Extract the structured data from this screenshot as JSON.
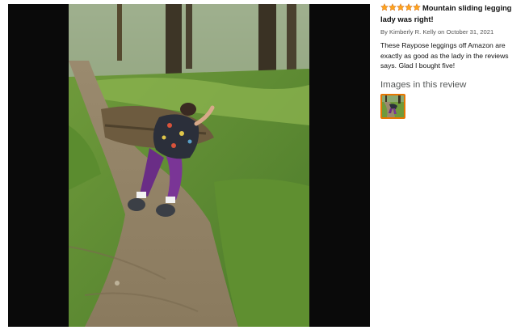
{
  "review": {
    "rating": 5,
    "title": "Mountain sliding legging lady was right!",
    "byline_prefix": "By",
    "author": "Kimberly R. Kelly",
    "date_prefix": "on",
    "date": "October 31, 2021",
    "body": "These Raypose leggings off Amazon are exactly as good as the lady in the reviews says. Glad I bought five!",
    "images_heading": "Images in this review",
    "star_color": "#ffa41c",
    "thumb_border_color": "#e77600"
  }
}
